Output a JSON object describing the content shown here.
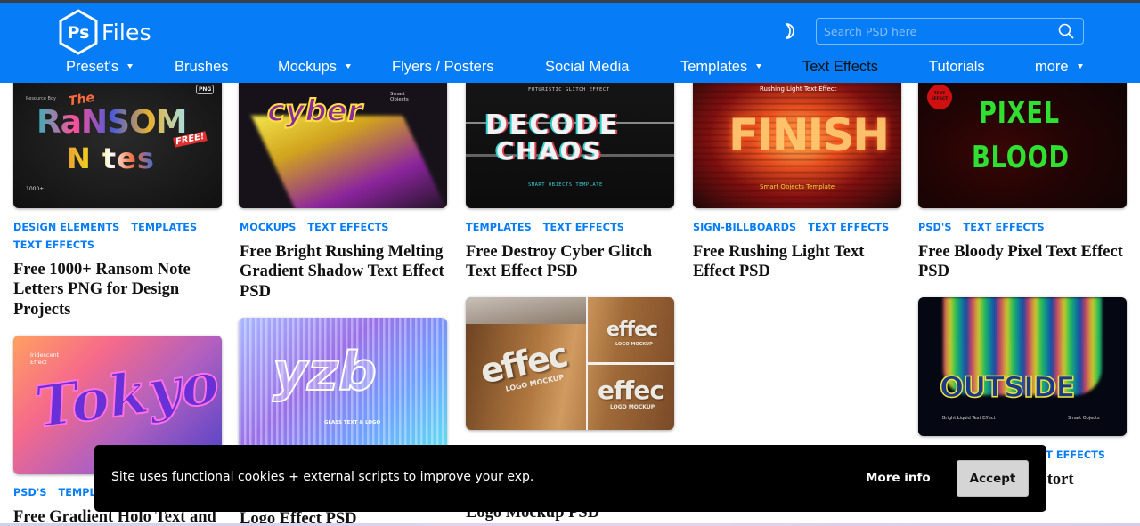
{
  "header": {
    "logo_mark": "Ps",
    "logo_text": "Files",
    "search": {
      "placeholder": "Search PSD here",
      "value": ""
    },
    "brand_color": "#067df7"
  },
  "nav": {
    "items": [
      {
        "label": "Preset's",
        "has_dropdown": true,
        "active": false
      },
      {
        "label": "Brushes",
        "has_dropdown": false,
        "active": false
      },
      {
        "label": "Mockups",
        "has_dropdown": true,
        "active": false
      },
      {
        "label": "Flyers / Posters",
        "has_dropdown": false,
        "active": false
      },
      {
        "label": "Social Media",
        "has_dropdown": false,
        "active": false
      },
      {
        "label": "Templates",
        "has_dropdown": true,
        "active": false
      },
      {
        "label": "Text Effects",
        "has_dropdown": false,
        "active": true
      },
      {
        "label": "Tutorials",
        "has_dropdown": false,
        "active": false
      },
      {
        "label": "more",
        "has_dropdown": true,
        "active": false
      }
    ]
  },
  "cards": [
    {
      "tags": [
        "DESIGN ELEMENTS",
        "TEMPLATES",
        "TEXT EFFECTS"
      ],
      "title": "Free 1000+ Ransom Note Letters PNG for Design Projects",
      "image_text": {
        "line1": "The",
        "line2": "RaNSOM",
        "line3": "N tes",
        "badge": "PNG",
        "free": "FREE!",
        "count": "1000+",
        "top": "Resource Boy"
      }
    },
    {
      "tags": [
        "MOCKUPS",
        "TEXT EFFECTS"
      ],
      "title": "Free Bright Rushing Melting Gradient Shadow Text Effect PSD",
      "image_text": {
        "main": "cyber",
        "note": "Smart Objects"
      }
    },
    {
      "tags": [
        "TEMPLATES",
        "TEXT EFFECTS"
      ],
      "title": "Free Destroy Cyber Glitch Text Effect PSD",
      "image_text": {
        "top": "FUTURISTIC GLITCH EFFECT",
        "line1": "DECODE",
        "line2": "CHAOS",
        "bottom": "SMART OBJECTS TEMPLATE"
      }
    },
    {
      "tags": [
        "SIGN-BILLBOARDS",
        "TEXT EFFECTS"
      ],
      "title": "Free Rushing Light Text Effect PSD",
      "image_text": {
        "top": "Rushing Light Text Effect",
        "main": "FINISH",
        "bottom": "Smart Objects Template"
      }
    },
    {
      "tags": [
        "PSD'S",
        "TEXT EFFECTS"
      ],
      "title": "Free Bloody Pixel Text Effect PSD",
      "image_text": {
        "badge": "TEXT EFFECT",
        "line1": "PIXEL",
        "line2": "BLOOD"
      }
    },
    {
      "tags": [
        "PSD'S",
        "TEMPLATES"
      ],
      "title": "Free Gradient Holo Text and",
      "image_text": {
        "note": "Iridescent Effect",
        "main": "Tokyo"
      }
    },
    {
      "tags": [],
      "title": "Logo Effect PSD",
      "image_text": {
        "main": "yzb",
        "bottom": "GLASS TEXT & LOGO"
      }
    },
    {
      "tags": [],
      "title": "Logo Mockup PSD",
      "image_text": {
        "main": "effec",
        "sub": "LOGO MOCKUP"
      }
    },
    {
      "tags": [
        "TEXT EFFECTS"
      ],
      "title": "Distort",
      "image_text": {
        "main": "OUTSIDE",
        "left": "Bright Liquid Text Effect",
        "right": "Smart Objects"
      }
    }
  ],
  "cookie": {
    "message": "Site uses functional cookies + external scripts to improve your exp.",
    "more_info": "More info",
    "accept": "Accept"
  }
}
